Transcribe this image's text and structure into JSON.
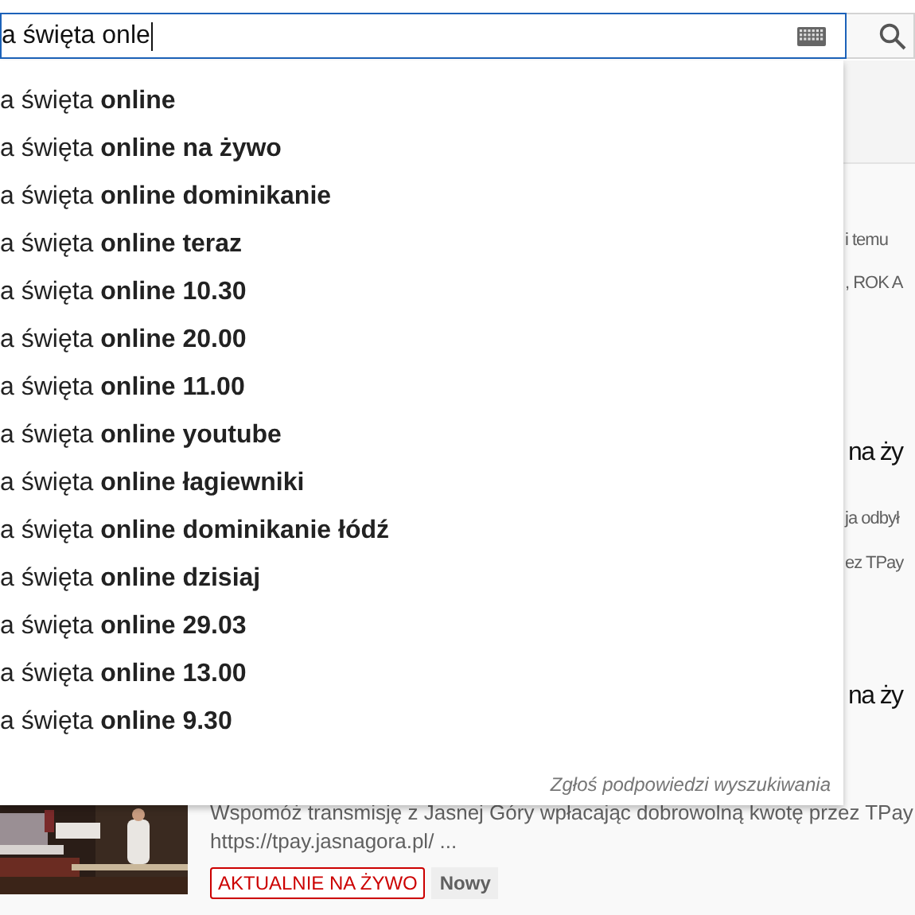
{
  "search": {
    "value": "a święta onle"
  },
  "suggestions": [
    "a święta **online**",
    "a święta **online na żywo**",
    "a święta **online dominikanie**",
    "a święta **online teraz**",
    "a święta **online 10.30**",
    "a święta **online 20.00**",
    "a święta **online 11.00**",
    "a święta **online youtube**",
    "a święta **online łagiewniki**",
    "a święta **online dominikanie łódź**",
    "a święta **online dzisiaj**",
    "a święta **online 29.03**",
    "a święta **online 13.00**",
    "a święta **online 9.30**"
  ],
  "report_link": "Zgłoś podpowiedzi wyszukiwania",
  "background_results": [
    {
      "kind": "meta",
      "text": "i temu"
    },
    {
      "kind": "meta",
      "text": ", ROK A"
    },
    {
      "kind": "title",
      "text": "na ży"
    },
    {
      "kind": "meta",
      "text": "ja odbył"
    },
    {
      "kind": "meta",
      "text": "ez TPay"
    },
    {
      "kind": "title",
      "text": "na ży"
    }
  ],
  "video": {
    "description": "Wspomóż transmisję z Jasnej Góry wpłacając dobrowolną kwotę przez TPay",
    "url": "https://tpay.jasnagora.pl/ ...",
    "badges": [
      {
        "kind": "live",
        "text": "AKTUALNIE NA ŻYWO"
      },
      {
        "kind": "new",
        "text": "Nowy"
      }
    ]
  }
}
